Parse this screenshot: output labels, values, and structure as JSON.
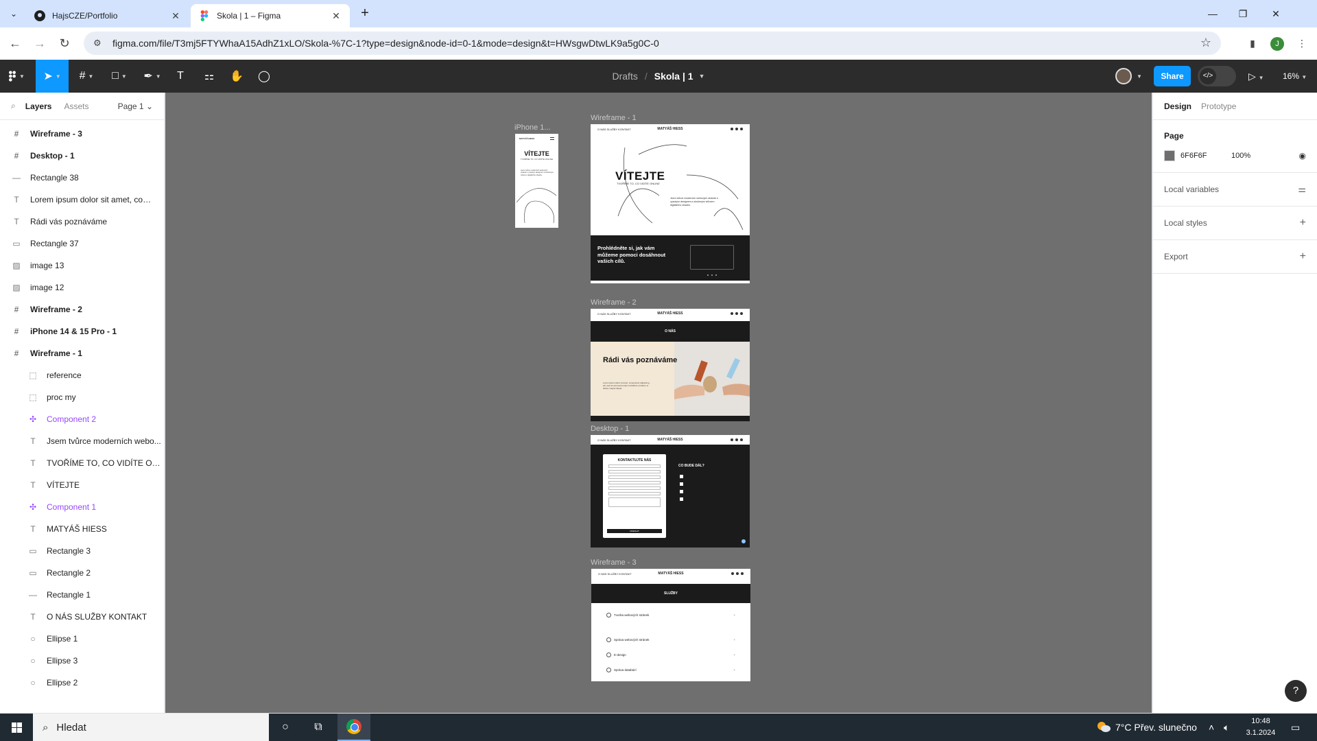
{
  "browser": {
    "tabs": [
      {
        "title": "HajsCZE/Portfolio",
        "active": false,
        "favicon": "github-icon"
      },
      {
        "title": "Skola | 1 – Figma",
        "active": true,
        "favicon": "figma-icon"
      }
    ],
    "url": "figma.com/file/T3mj5FTYWhaA15AdhZ1xLO/Skola-%7C-1?type=design&node-id=0-1&mode=design&t=HWsgwDtwLK9a5g0C-0",
    "profile_initial": "J"
  },
  "toolbar": {
    "breadcrumb_parent": "Drafts",
    "breadcrumb_sep": "/",
    "file_name": "Skola | 1",
    "share_label": "Share",
    "zoom": "16%"
  },
  "layers_panel": {
    "tab_layers": "Layers",
    "tab_assets": "Assets",
    "page": "Page 1",
    "items": [
      {
        "name": "Wireframe - 3",
        "type": "frame",
        "level": 0
      },
      {
        "name": "Desktop - 1",
        "type": "frame",
        "level": 0
      },
      {
        "name": "Rectangle 38",
        "type": "line",
        "level": 0
      },
      {
        "name": "Lorem ipsum dolor sit amet, conse...",
        "type": "text",
        "level": 0
      },
      {
        "name": "Rádi vás poznáváme",
        "type": "text",
        "level": 0
      },
      {
        "name": "Rectangle 37",
        "type": "rect",
        "level": 0
      },
      {
        "name": "image 13",
        "type": "image",
        "level": 0
      },
      {
        "name": "image 12",
        "type": "image",
        "level": 0
      },
      {
        "name": "Wireframe - 2",
        "type": "frame",
        "level": 0
      },
      {
        "name": "iPhone 14 & 15 Pro - 1",
        "type": "frame",
        "level": 0
      },
      {
        "name": "Wireframe - 1",
        "type": "frame",
        "level": 0
      },
      {
        "name": "reference",
        "type": "section",
        "level": 1
      },
      {
        "name": "proc my",
        "type": "section",
        "level": 1
      },
      {
        "name": "Component 2",
        "type": "component",
        "level": 1
      },
      {
        "name": "Jsem tvůrce moderních webo...",
        "type": "text",
        "level": 1
      },
      {
        "name": "TVOŘÍME TO, CO VIDÍTE ON...",
        "type": "text",
        "level": 1
      },
      {
        "name": "VÍTEJTE",
        "type": "text",
        "level": 1
      },
      {
        "name": "Component 1",
        "type": "component",
        "level": 1
      },
      {
        "name": "MATYÁŠ HIESS",
        "type": "text",
        "level": 1
      },
      {
        "name": "Rectangle 3",
        "type": "rect",
        "level": 1
      },
      {
        "name": "Rectangle 2",
        "type": "rect",
        "level": 1
      },
      {
        "name": "Rectangle 1",
        "type": "line",
        "level": 1
      },
      {
        "name": "O NÁS SLUŽBY KONTAKT",
        "type": "text",
        "level": 1
      },
      {
        "name": "Ellipse 1",
        "type": "ellipse",
        "level": 1
      },
      {
        "name": "Ellipse 3",
        "type": "ellipse",
        "level": 1
      },
      {
        "name": "Ellipse 2",
        "type": "ellipse",
        "level": 1
      }
    ]
  },
  "canvas": {
    "background": "#6F6F6F",
    "frames": {
      "iphone_label": "iPhone 1...",
      "wf1_label": "Wireframe - 1",
      "wf2_label": "Wireframe - 2",
      "desktop_label": "Desktop - 1",
      "wf3_label": "Wireframe - 3"
    },
    "nav_links": "O NÁS SLUŽBY KONTAKT",
    "logo": "MATYÁŠ HIESS",
    "wf1": {
      "hero_title": "VÍTEJTE",
      "hero_sub": "TVOŘÍME TO, CO VIDÍTE ONLINE",
      "hero_text": "Jsem tvůrce moderních webových stránek s vysokým designem a zkušeným tvůrcem digitálního obsahu.",
      "dark_heading": "Prohlédněte si, jak vám můžeme pomoci dosáhnout vašich cílů."
    },
    "wf2": {
      "band": "O NÁS",
      "title": "Rádi vás poznáváme",
      "text": "Lorem ipsum dolor sit amet, consectetur adipiscing elit, sed do eiusmod tempor incididunt ut labore et dolore magna aliqua."
    },
    "desktop1": {
      "form_title": "KONTAKTUJTE NÁS",
      "submit": "ODESLAT",
      "next_title": "CO BUDE DÁL?"
    },
    "wf3": {
      "band": "SLUŽBY",
      "rows": [
        "Tvorba webových stránek",
        "Správa webových stránek",
        "E-design",
        "Správa databází"
      ]
    }
  },
  "design_panel": {
    "tab_design": "Design",
    "tab_prototype": "Prototype",
    "page_section": "Page",
    "page_color_hex": "6F6F6F",
    "page_color_opacity": "100%",
    "local_variables": "Local variables",
    "local_styles": "Local styles",
    "export": "Export",
    "help": "?"
  },
  "taskbar": {
    "search_placeholder": "Hledat",
    "weather": "7°C  Přev. slunečno",
    "time": "10:48",
    "date": "3.1.2024"
  }
}
